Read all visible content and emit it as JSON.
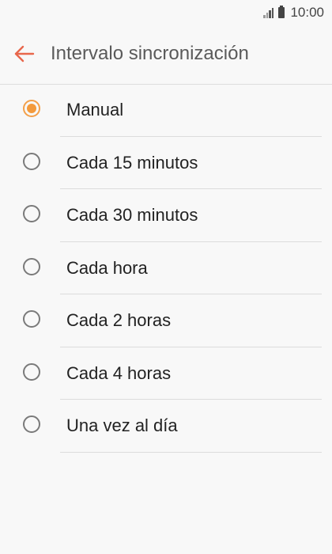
{
  "status_bar": {
    "time": "10:00",
    "signal_icon": "signal-icon",
    "battery_icon": "battery-icon"
  },
  "header": {
    "title": "Intervalo sincronización",
    "back_icon": "back-arrow-icon",
    "accent_color": "#e8674c"
  },
  "options": {
    "selected_index": 0,
    "accent_color": "#f39a3c",
    "items": [
      {
        "label": "Manual",
        "selected": true
      },
      {
        "label": "Cada 15 minutos",
        "selected": false
      },
      {
        "label": "Cada 30 minutos",
        "selected": false
      },
      {
        "label": "Cada hora",
        "selected": false
      },
      {
        "label": "Cada 2 horas",
        "selected": false
      },
      {
        "label": "Cada 4 horas",
        "selected": false
      },
      {
        "label": "Una vez al día",
        "selected": false
      }
    ]
  }
}
